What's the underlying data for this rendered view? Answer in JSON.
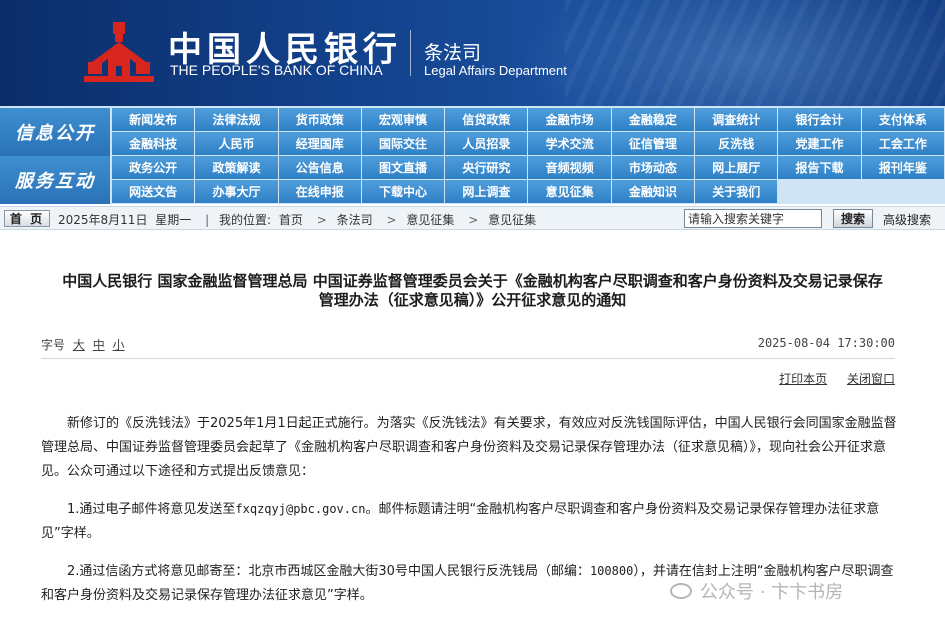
{
  "banner": {
    "bank_cn": "中国人民银行",
    "bank_en": "THE PEOPLE'S BANK OF CHINA",
    "dept_cn": "条法司",
    "dept_en": "Legal Affairs Department",
    "logo_icon": "pboc-emblem-icon",
    "logo_color": "#d7261e"
  },
  "nav": {
    "section1": "信息公开",
    "section2": "服务互动",
    "row1": [
      "新闻发布",
      "法律法规",
      "货币政策",
      "宏观审慎",
      "信贷政策",
      "金融市场",
      "金融稳定",
      "调查统计",
      "银行会计",
      "支付体系"
    ],
    "row2": [
      "金融科技",
      "人民币",
      "经理国库",
      "国际交往",
      "人员招录",
      "学术交流",
      "征信管理",
      "反洗钱",
      "党建工作",
      "工会工作"
    ],
    "row3": [
      "政务公开",
      "政策解读",
      "公告信息",
      "图文直播",
      "央行研究",
      "音频视频",
      "市场动态",
      "网上展厅",
      "报告下载",
      "报刊年鉴"
    ],
    "row4": [
      "网送文告",
      "办事大厅",
      "在线申报",
      "下载中心",
      "网上调查",
      "意见征集",
      "金融知识",
      "关于我们"
    ]
  },
  "crumb": {
    "home": "首 页",
    "date": "2025年8月11日",
    "weekday": "星期一",
    "location_label": "我的位置:",
    "path": [
      "首页",
      "条法司",
      "意见征集",
      "意见征集"
    ],
    "search_placeholder": "请输入搜索关键字",
    "search_button": "搜索",
    "advanced_search": "高级搜索"
  },
  "article": {
    "title_line1": "中国人民银行  国家金融监督管理总局  中国证券监督管理委员会关于《金融机构客户尽职调查和客户身份资料及交易记录保存",
    "title_line2": "管理办法（征求意见稿）》公开征求意见的通知",
    "font_size_label": "字号",
    "font_large": "大",
    "font_medium": "中",
    "font_small": "小",
    "publish_time": "2025-08-04 17:30:00",
    "print_label": "打印本页",
    "close_label": "关闭窗口",
    "para1": "新修订的《反洗钱法》于2025年1月1日起正式施行。为落实《反洗钱法》有关要求，有效应对反洗钱国际评估，中国人民银行会同国家金融监督管理总局、中国证券监督管理委员会起草了《金融机构客户尽职调查和客户身份资料及交易记录保存管理办法（征求意见稿）》，现向社会公开征求意见。公众可通过以下途径和方式提出反馈意见：",
    "para2_pre": "1.通过电子邮件将意见发送至",
    "para2_email": "fxqzqyj@pbc.gov.cn",
    "para2_post": "。邮件标题请注明“金融机构客户尽职调查和客户身份资料及交易记录保存管理办法征求意见”字样。",
    "para3_pre": "2.通过信函方式将意见邮寄至：北京市西城区金融大街30号中国人民银行反洗钱局（邮编：",
    "para3_zip": "100800",
    "para3_post": "），并请在信封上注明“金融机构客户尽职调查和客户身份资料及交易记录保存管理办法征求意见”字样。"
  },
  "watermark": {
    "text": "公众号 · 卞卞书房"
  }
}
